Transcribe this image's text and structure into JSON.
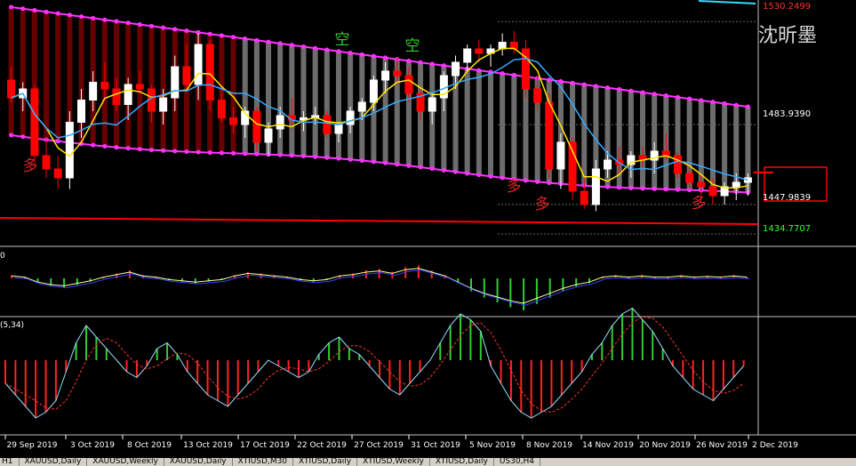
{
  "watermark": "沈昕墨",
  "indicators": {
    "macd_label": "0",
    "osc_label": "(5,34)"
  },
  "tabs": [
    "H1",
    "XAUUSD,Daily",
    "XAUUSD,Weekly",
    "XAUUSD,Daily",
    "XTIUSD,M30",
    "XTIUSD,Daily",
    "XTIUSD,Weekly",
    "XTIUSD,Daily",
    "US30,H4"
  ],
  "colors": {
    "background": "#000000",
    "bull_candle": "#ffffff",
    "bear_candle": "#ff0000",
    "channel": "#ff33ff",
    "fast_ma": "#ffe600",
    "slow_ma": "#33aaff",
    "support_line": "#ff0000",
    "hist_up": "#33cc33",
    "hist_down": "#ff2222"
  },
  "chart_data": {
    "type": "candlestick",
    "x_ticks": [
      "29 Sep 2019",
      "3 Oct 2019",
      "8 Oct 2019",
      "13 Oct 2019",
      "17 Oct 2019",
      "22 Oct 2019",
      "27 Oct 2019",
      "31 Oct 2019",
      "5 Nov 2019",
      "8 Nov 2019",
      "14 Nov 2019",
      "20 Nov 2019",
      "26 Nov 2019",
      "2 Dec 2019"
    ],
    "price_labels": [
      {
        "value": 1530.2499,
        "text": "1530.2499",
        "color": "#ff3333"
      },
      {
        "value": 1483.939,
        "text": "1483.9390",
        "color": "#ffffff"
      },
      {
        "value": 1447.9839,
        "text": "1447.9839",
        "color": "#ffffff"
      },
      {
        "value": 1434.7707,
        "text": "1434.7707",
        "color": "#33ff33"
      }
    ],
    "ylim": [
      1430,
      1540
    ],
    "candles": [
      [
        1504,
        1510,
        1494,
        1496
      ],
      [
        1496,
        1503,
        1490,
        1500
      ],
      [
        1500,
        1502,
        1466,
        1470
      ],
      [
        1470,
        1478,
        1460,
        1464
      ],
      [
        1464,
        1470,
        1455,
        1460
      ],
      [
        1460,
        1490,
        1455,
        1485
      ],
      [
        1485,
        1500,
        1478,
        1495
      ],
      [
        1495,
        1508,
        1490,
        1503
      ],
      [
        1503,
        1512,
        1496,
        1500
      ],
      [
        1500,
        1505,
        1490,
        1493
      ],
      [
        1493,
        1505,
        1486,
        1502
      ],
      [
        1502,
        1508,
        1498,
        1500
      ],
      [
        1500,
        1502,
        1485,
        1490
      ],
      [
        1490,
        1500,
        1484,
        1496
      ],
      [
        1496,
        1515,
        1490,
        1510
      ],
      [
        1510,
        1520,
        1500,
        1502
      ],
      [
        1502,
        1525,
        1495,
        1520
      ],
      [
        1520,
        1522,
        1490,
        1495
      ],
      [
        1495,
        1500,
        1485,
        1487
      ],
      [
        1487,
        1492,
        1480,
        1484
      ],
      [
        1484,
        1492,
        1478,
        1490
      ],
      [
        1490,
        1492,
        1472,
        1476
      ],
      [
        1476,
        1485,
        1470,
        1482
      ],
      [
        1482,
        1492,
        1478,
        1488
      ],
      [
        1488,
        1496,
        1482,
        1486
      ],
      [
        1486,
        1490,
        1481,
        1487
      ],
      [
        1487,
        1492,
        1484,
        1488
      ],
      [
        1488,
        1490,
        1478,
        1480
      ],
      [
        1480,
        1485,
        1476,
        1484
      ],
      [
        1484,
        1492,
        1480,
        1490
      ],
      [
        1490,
        1496,
        1486,
        1494
      ],
      [
        1494,
        1506,
        1490,
        1504
      ],
      [
        1504,
        1512,
        1498,
        1508
      ],
      [
        1508,
        1514,
        1502,
        1506
      ],
      [
        1506,
        1510,
        1494,
        1498
      ],
      [
        1498,
        1500,
        1486,
        1490
      ],
      [
        1490,
        1498,
        1484,
        1496
      ],
      [
        1496,
        1508,
        1490,
        1506
      ],
      [
        1506,
        1515,
        1500,
        1512
      ],
      [
        1512,
        1520,
        1508,
        1518
      ],
      [
        1518,
        1522,
        1512,
        1516
      ],
      [
        1516,
        1520,
        1510,
        1518
      ],
      [
        1518,
        1525,
        1515,
        1521
      ],
      [
        1521,
        1526,
        1516,
        1518
      ],
      [
        1518,
        1522,
        1496,
        1500
      ],
      [
        1500,
        1506,
        1490,
        1494
      ],
      [
        1494,
        1498,
        1460,
        1464
      ],
      [
        1464,
        1480,
        1455,
        1476
      ],
      [
        1476,
        1478,
        1450,
        1454
      ],
      [
        1454,
        1460,
        1446,
        1448
      ],
      [
        1448,
        1468,
        1445,
        1464
      ],
      [
        1464,
        1472,
        1460,
        1468
      ],
      [
        1468,
        1474,
        1462,
        1466
      ],
      [
        1466,
        1472,
        1460,
        1470
      ],
      [
        1470,
        1474,
        1464,
        1468
      ],
      [
        1468,
        1476,
        1462,
        1472
      ],
      [
        1472,
        1480,
        1468,
        1470
      ],
      [
        1470,
        1472,
        1460,
        1462
      ],
      [
        1462,
        1466,
        1455,
        1458
      ],
      [
        1458,
        1462,
        1450,
        1456
      ],
      [
        1456,
        1460,
        1448,
        1452
      ],
      [
        1452,
        1458,
        1448,
        1456
      ],
      [
        1456,
        1462,
        1450,
        1458
      ],
      [
        1458,
        1462,
        1452,
        1460
      ]
    ],
    "annotations": [
      {
        "text": "多",
        "color": "#dd2222"
      },
      {
        "text": "空",
        "color": "#33cc33"
      },
      {
        "text": "空",
        "color": "#33cc33"
      },
      {
        "text": "多",
        "color": "#dd2222"
      },
      {
        "text": "多",
        "color": "#dd2222"
      },
      {
        "text": "多",
        "color": "#dd2222"
      }
    ],
    "macd": [
      0.2,
      0.1,
      -0.3,
      -0.5,
      -0.6,
      -0.4,
      -0.2,
      0.1,
      0.3,
      0.5,
      0.2,
      0.1,
      -0.1,
      -0.2,
      -0.3,
      -0.2,
      -0.1,
      0.2,
      0.4,
      0.3,
      0.2,
      0.1,
      -0.1,
      -0.2,
      -0.1,
      0.2,
      0.3,
      0.5,
      0.6,
      0.4,
      0.7,
      0.8,
      0.5,
      0.2,
      -0.3,
      -0.8,
      -1.2,
      -1.5,
      -1.8,
      -2.0,
      -1.6,
      -1.2,
      -0.8,
      -0.5,
      -0.3,
      0.1,
      0.2,
      0.1,
      0.2,
      0.1,
      0.1,
      0.2,
      0.1,
      0.15,
      0.1,
      0.2,
      0.1
    ],
    "osc": [
      -4,
      -6,
      -8,
      -10,
      -9,
      -7,
      -2,
      3,
      6,
      4,
      2,
      0,
      -2,
      -3,
      -1,
      2,
      3,
      1,
      -2,
      -4,
      -6,
      -7,
      -8,
      -6,
      -4,
      -2,
      0,
      -1,
      -2,
      -3,
      -2,
      1,
      3,
      4,
      2,
      1,
      -1,
      -3,
      -5,
      -6,
      -4,
      -2,
      0,
      3,
      6,
      8,
      7,
      5,
      -1,
      -4,
      -7,
      -9,
      -10,
      -9,
      -8,
      -6,
      -4,
      -2,
      1,
      3,
      6,
      8,
      9,
      7,
      5,
      2,
      -1,
      -3,
      -5,
      -6,
      -7,
      -5,
      -3,
      -1
    ]
  }
}
